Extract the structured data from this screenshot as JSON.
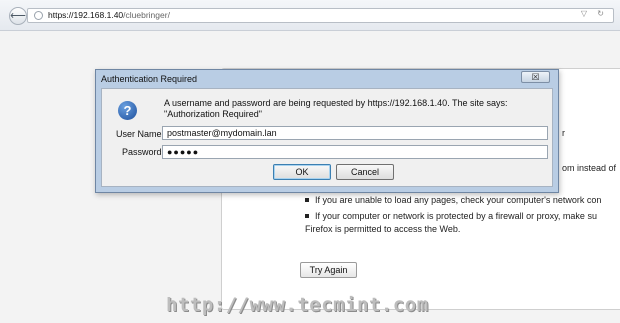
{
  "browser": {
    "url_host": "https://192.168.1.40",
    "url_path": "/cluebringer/",
    "url_arrows": "▽ ↻",
    "back_glyph": "⟵"
  },
  "page": {
    "partial_line_1": "om instead of",
    "partial_line_2": "r",
    "bullets": [
      {
        "text": "If you are unable to load any pages, check your computer's network con"
      },
      {
        "text": "If your computer or network is protected by a firewall or proxy, make su",
        "text2": "Firefox is permitted to access the Web."
      }
    ],
    "try_again_label": "Try Again",
    "watermark": "http://www.tecmint.com"
  },
  "dialog": {
    "title": "Authentication Required",
    "close_glyph": "☒",
    "icon_glyph": "?",
    "message": "A username and password are being requested by https://192.168.1.40. The site says: \"Authorization Required\"",
    "username_label": "User Name:",
    "username_value": "postmaster@mydomain.lan",
    "password_label": "Password:",
    "password_value": "●●●●●",
    "ok_label": "OK",
    "cancel_label": "Cancel"
  }
}
